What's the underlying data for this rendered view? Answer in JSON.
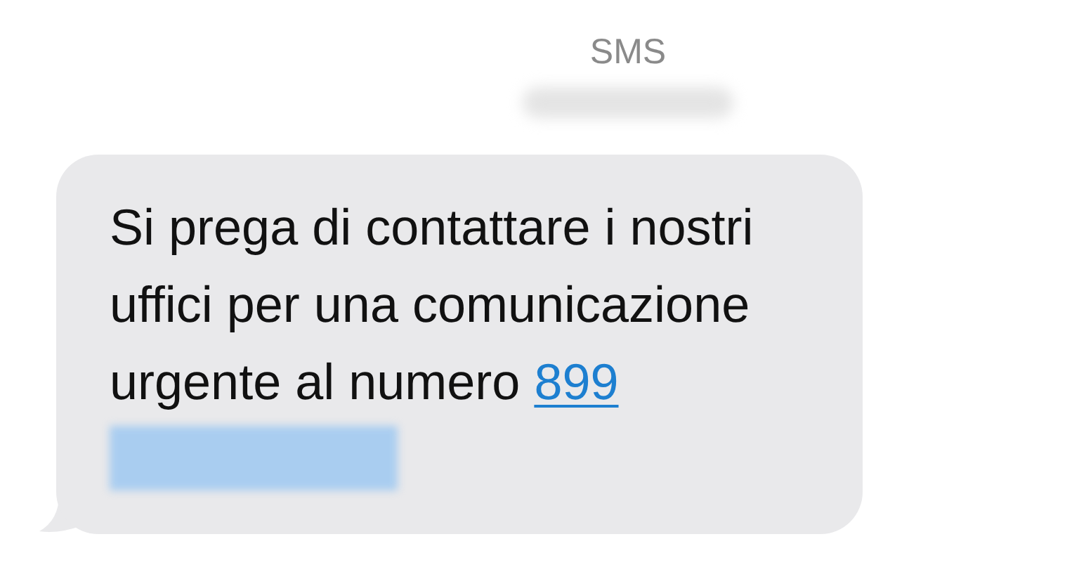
{
  "header": {
    "title": "SMS"
  },
  "message": {
    "text": "Si prega di contattare i nostri uffici per una comunicazione urgente al numero",
    "link": "899"
  }
}
